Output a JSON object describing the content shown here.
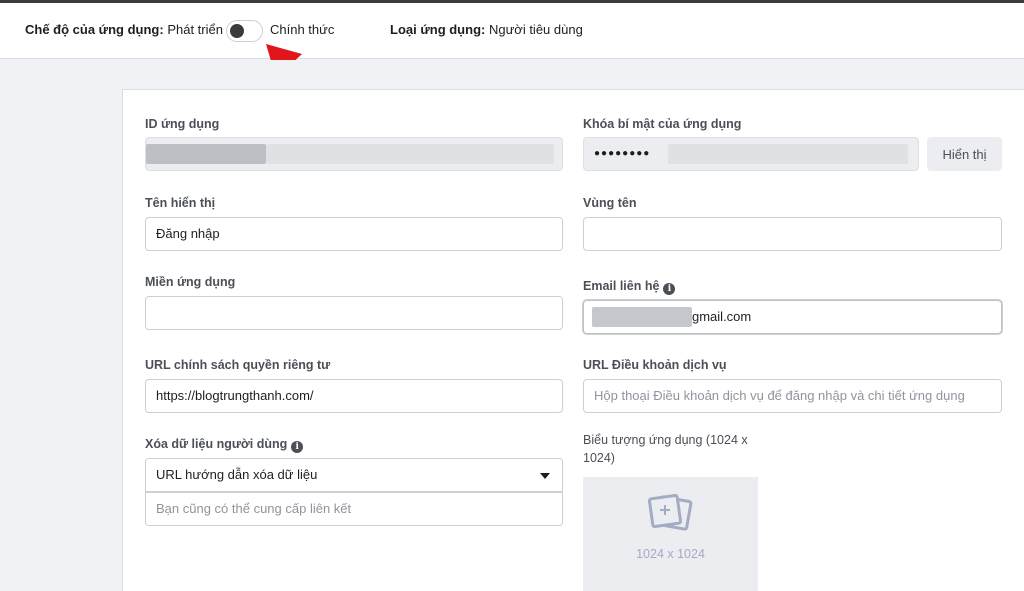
{
  "mode_bar": {
    "app_mode_label": "Chế độ của ứng dụng:",
    "mode_dev": "Phát triển",
    "mode_live": "Chính thức",
    "app_type_label": "Loại ứng dụng:",
    "app_type_value": "Người tiêu dùng",
    "toggle_state": "off"
  },
  "form": {
    "app_id": {
      "label": "ID ứng dụng",
      "value": ""
    },
    "app_secret": {
      "label": "Khóa bí mật của ứng dụng",
      "value": "●●●●●●●●",
      "show_button": "Hiển thị"
    },
    "display_name": {
      "label": "Tên hiển thị",
      "value": "Đăng nhập"
    },
    "namespace": {
      "label": "Vùng tên",
      "value": ""
    },
    "app_domains": {
      "label": "Miền ứng dụng",
      "value": ""
    },
    "contact_email": {
      "label": "Email liên hệ",
      "value": "gmail.com"
    },
    "privacy_url": {
      "label": "URL chính sách quyền riêng tư",
      "value": "https://blogtrungthanh.com/"
    },
    "terms_url": {
      "label": "URL Điều khoản dịch vụ",
      "placeholder": "Hộp thoại Điều khoản dịch vụ để đăng nhập và chi tiết ứng dụng"
    },
    "data_deletion": {
      "label": "Xóa dữ liệu người dùng",
      "selected": "URL hướng dẫn xóa dữ liệu",
      "placeholder": "Bạn cũng có thể cung cấp liên kết"
    },
    "app_icon": {
      "label_line1": "Biểu tượng ứng dụng (1024 x",
      "label_line2": "1024)",
      "size_text": "1024 x 1024"
    }
  },
  "colors": {
    "accent_arrow": "#e0161b",
    "border": "#ccd0d5",
    "disabled_bg": "#ebedf0"
  }
}
